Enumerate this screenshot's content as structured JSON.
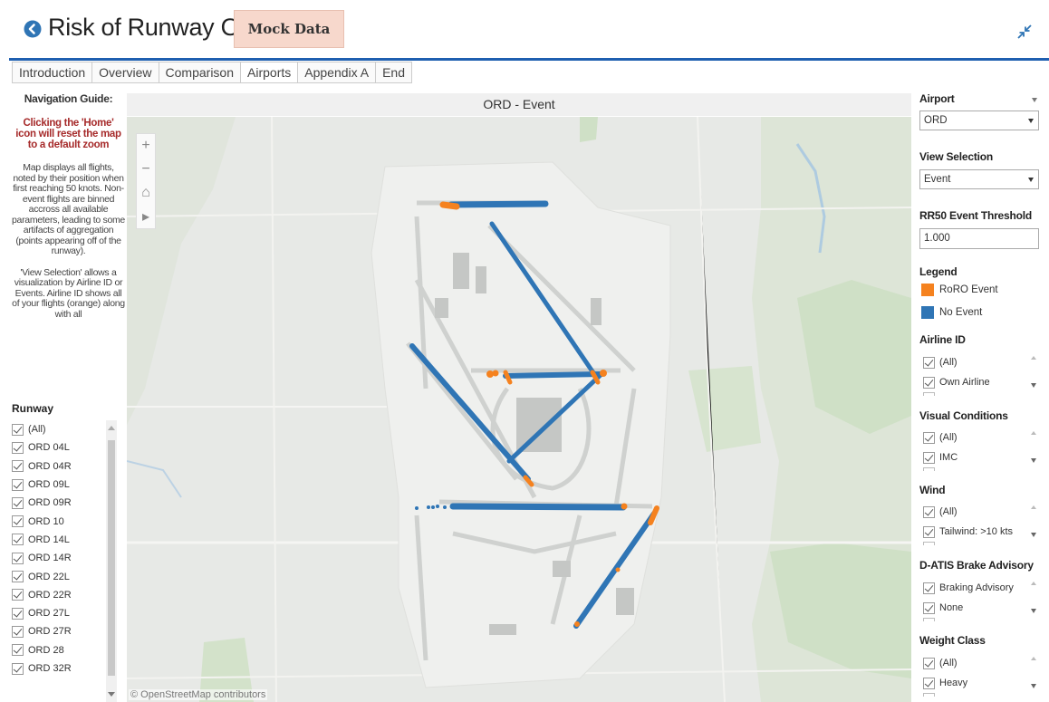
{
  "header": {
    "title": "Risk of Runway Overrun",
    "badge": "Mock Data",
    "accent_color": "#1f5fb0",
    "icons": [
      "back-arrow-icon",
      "collapse-icon"
    ]
  },
  "tabs": [
    {
      "label": "Introduction"
    },
    {
      "label": "Overview"
    },
    {
      "label": "Comparison"
    },
    {
      "label": "Airports",
      "active": true
    },
    {
      "label": "Appendix A"
    },
    {
      "label": "End"
    }
  ],
  "left_panel": {
    "nav_heading": "Navigation Guide:",
    "nav_warning": "Clicking the 'Home' icon will reset the map to a default zoom",
    "nav_text_1": "Map displays all flights, noted by their position when first reaching 50 knots.  Non-event flights are binned accross all available parameters, leading to some artifacts of aggregation (points appearing off of the runway).",
    "nav_text_2": "'View Selection' allows a visualization by Airline ID or Events.  Airline ID shows all of your flights (orange) along with all",
    "runway_heading": "Runway",
    "runways": [
      "(All)",
      "ORD 04L",
      "ORD 04R",
      "ORD 09L",
      "ORD 09R",
      "ORD 10",
      "ORD 14L",
      "ORD 14R",
      "ORD 22L",
      "ORD 22R",
      "ORD 27L",
      "ORD 27R",
      "ORD 28",
      "ORD 32R"
    ]
  },
  "map": {
    "title": "ORD - Event",
    "attribution": "© OpenStreetMap contributors",
    "controls": {
      "zoom_in": "+",
      "zoom_out": "−",
      "home": "⌂",
      "play": "▸"
    }
  },
  "right_panel": {
    "airport_label": "Airport",
    "airport_value": "ORD",
    "view_label": "View Selection",
    "view_value": "Event",
    "threshold_label": "RR50 Event Threshold",
    "threshold_value": "1.000",
    "legend_label": "Legend",
    "legend": [
      {
        "label": "RoRO Event",
        "color": "#f5821f"
      },
      {
        "label": "No Event",
        "color": "#2f75b5"
      }
    ],
    "filters": [
      {
        "title": "Airline ID",
        "items": [
          "(All)",
          "Own Airline"
        ]
      },
      {
        "title": "Visual Conditions",
        "items": [
          "(All)",
          "IMC"
        ]
      },
      {
        "title": "Wind",
        "items": [
          "(All)",
          "Tailwind: >10 kts"
        ]
      },
      {
        "title": "D-ATIS Brake Advisory",
        "items": [
          "Braking Advisory",
          "None"
        ]
      },
      {
        "title": "Weight Class",
        "items": [
          "(All)",
          "Heavy"
        ]
      }
    ]
  }
}
